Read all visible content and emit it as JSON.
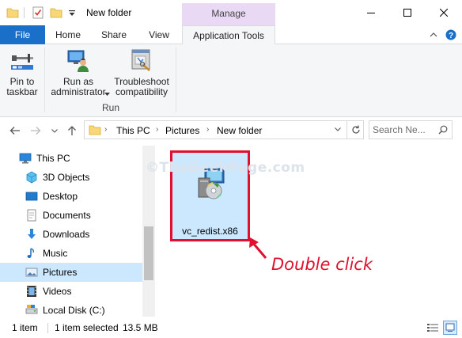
{
  "titlebar": {
    "title": "New folder",
    "context_tab": "Manage"
  },
  "ribbon": {
    "tabs": [
      "File",
      "Home",
      "Share",
      "View",
      "Application Tools"
    ],
    "active_tab": "Application Tools",
    "buttons": {
      "pin": "Pin to\ntaskbar",
      "run_as": "Run as\nadministrator",
      "troubleshoot": "Troubleshoot\ncompatibility"
    },
    "group_label": "Run"
  },
  "address": {
    "crumbs": [
      "This PC",
      "Pictures",
      "New folder"
    ]
  },
  "search": {
    "placeholder": "Search Ne..."
  },
  "nav": {
    "items": [
      {
        "label": "This PC",
        "icon": "computer-icon"
      },
      {
        "label": "3D Objects",
        "icon": "cube-icon"
      },
      {
        "label": "Desktop",
        "icon": "desktop-icon"
      },
      {
        "label": "Documents",
        "icon": "documents-icon"
      },
      {
        "label": "Downloads",
        "icon": "download-arrow-icon"
      },
      {
        "label": "Music",
        "icon": "music-note-icon"
      },
      {
        "label": "Pictures",
        "icon": "pictures-icon"
      },
      {
        "label": "Videos",
        "icon": "film-icon"
      },
      {
        "label": "Local Disk (C:)",
        "icon": "disk-icon"
      }
    ],
    "selected": "Pictures"
  },
  "content": {
    "files": [
      {
        "name": "vc_redist.x86",
        "icon": "installer-icon",
        "selected": true
      }
    ],
    "watermark": "©TheGeekPage.com",
    "annotation": "Double click"
  },
  "status": {
    "count": "1 item",
    "selection": "1 item selected",
    "size": "13.5 MB"
  },
  "colors": {
    "accent": "#1a6fc9",
    "selection": "#cce8ff",
    "annotation": "#e0102e",
    "manage_tab": "#e9d9f5"
  }
}
